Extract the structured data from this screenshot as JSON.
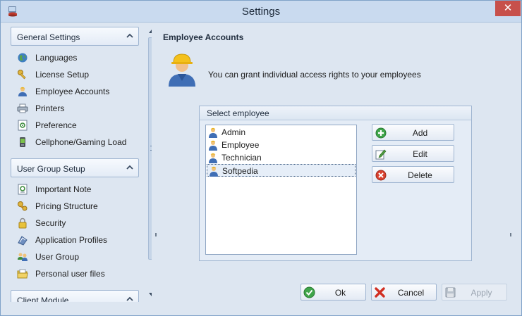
{
  "window": {
    "title": "Settings",
    "close_glyph": "✕"
  },
  "nav": {
    "groups": [
      {
        "label": "General Settings",
        "items": [
          {
            "label": "Languages",
            "icon": "globe-icon"
          },
          {
            "label": "License Setup",
            "icon": "key-icon"
          },
          {
            "label": "Employee Accounts",
            "icon": "user-icon"
          },
          {
            "label": "Printers",
            "icon": "printer-icon"
          },
          {
            "label": "Preference",
            "icon": "preference-icon"
          },
          {
            "label": "Cellphone/Gaming Load",
            "icon": "cellphone-icon"
          }
        ]
      },
      {
        "label": "User Group Setup",
        "items": [
          {
            "label": "Important Note",
            "icon": "note-icon"
          },
          {
            "label": "Pricing Structure",
            "icon": "pricing-icon"
          },
          {
            "label": "Security",
            "icon": "lock-icon"
          },
          {
            "label": "Application Profiles",
            "icon": "application-icon"
          },
          {
            "label": "User Group",
            "icon": "users-icon"
          },
          {
            "label": "Personal user files",
            "icon": "files-icon"
          }
        ]
      },
      {
        "label": "Client Module",
        "items": []
      }
    ]
  },
  "content": {
    "section_title": "Employee Accounts",
    "intro_text": "You can grant individual access rights to your employees",
    "select_employee": {
      "header": "Select employee",
      "employees": [
        "Admin",
        "Employee",
        "Technician",
        "Softpedia"
      ],
      "selected": "Softpedia"
    },
    "actions": {
      "add": "Add",
      "edit": "Edit",
      "delete": "Delete"
    }
  },
  "footer": {
    "ok": "Ok",
    "cancel": "Cancel",
    "apply": "Apply",
    "apply_enabled": false
  },
  "colors": {
    "accent": "#c9daef",
    "close": "#c7504b",
    "selection": "#e6eef8"
  }
}
